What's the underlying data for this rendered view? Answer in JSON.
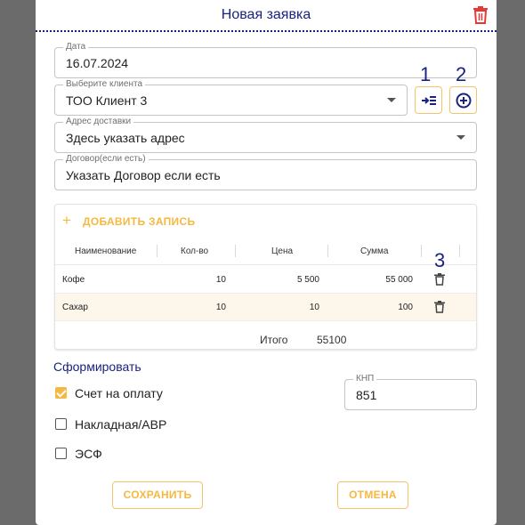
{
  "dialog": {
    "title": "Новая заявка"
  },
  "form": {
    "date": {
      "label": "Дата",
      "value": "16.07.2024"
    },
    "client": {
      "label": "Выберите клиента",
      "value": "ТОО Клиент 3"
    },
    "address": {
      "label": "Адрес доставки",
      "value": "Здесь указать адрес"
    },
    "contract": {
      "label": "Договор(если есть)",
      "value": "Указать Договор если есть"
    }
  },
  "annotations": [
    "1",
    "2",
    "3"
  ],
  "table": {
    "add_label": "ДОБАВИТЬ ЗАПИСЬ",
    "columns": [
      "Наименование",
      "Кол-во",
      "Цена",
      "Сумма"
    ],
    "rows": [
      {
        "name": "Кофе",
        "qty": "10",
        "price": "5 500",
        "sum": "55 000"
      },
      {
        "name": "Сахар",
        "qty": "10",
        "price": "10",
        "sum": "100"
      }
    ],
    "total_label": "Итого",
    "total_value": "55100"
  },
  "generate": {
    "label": "Сформировать",
    "options": [
      {
        "label": "Счет на оплату",
        "checked": true
      },
      {
        "label": "Накладная/АВР",
        "checked": false
      },
      {
        "label": "ЭСФ",
        "checked": false
      }
    ]
  },
  "knp": {
    "label": "КНП",
    "value": "851"
  },
  "actions": {
    "save": "СОХРАНИТЬ",
    "cancel": "ОТМЕНА"
  },
  "colors": {
    "accent": "#f5b841",
    "primary": "#1a237e",
    "danger": "#e53935"
  },
  "icons": {
    "delete": "trash-icon",
    "select_client": "arrow-list-icon",
    "add_client": "circle-plus-icon",
    "row_delete": "trash-icon"
  }
}
